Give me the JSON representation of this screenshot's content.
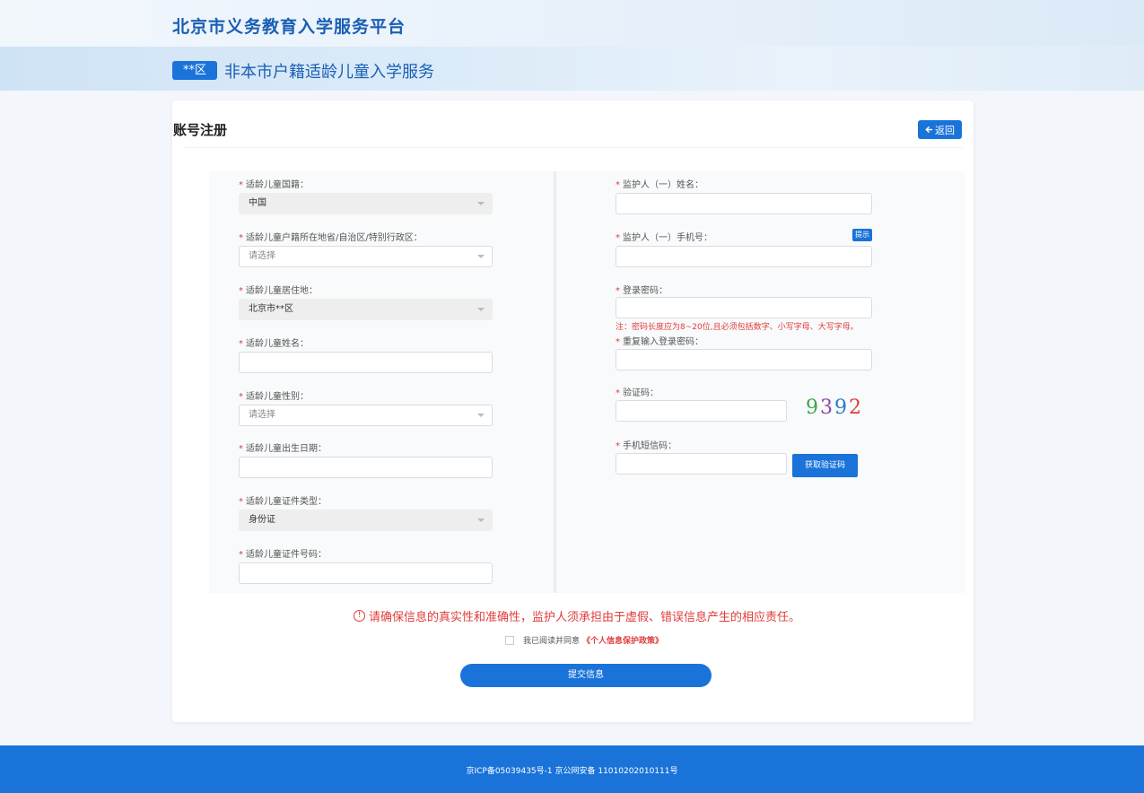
{
  "header": {
    "site_title": "北京市义务教育入学服务平台",
    "district_badge": "**区",
    "service_title": "非本市户籍适龄儿童入学服务"
  },
  "card": {
    "title": "账号注册",
    "back_label": "返回"
  },
  "left_fields": {
    "nationality": {
      "label": "适龄儿童国籍：",
      "value": "中国"
    },
    "huji_province": {
      "label": "适龄儿童户籍所在地省/自治区/特别行政区：",
      "placeholder": "请选择"
    },
    "residence": {
      "label": "适龄儿童居住地：",
      "value": "北京市**区"
    },
    "name": {
      "label": "适龄儿童姓名：",
      "value": ""
    },
    "gender": {
      "label": "适龄儿童性别：",
      "placeholder": "请选择"
    },
    "birthdate": {
      "label": "适龄儿童出生日期：",
      "value": ""
    },
    "id_type": {
      "label": "适龄儿童证件类型：",
      "value": "身份证"
    },
    "id_number": {
      "label": "适龄儿童证件号码：",
      "value": ""
    }
  },
  "right_fields": {
    "guardian_name": {
      "label": "监护人（一）姓名：",
      "value": ""
    },
    "guardian_phone": {
      "label": "监护人（一）手机号：",
      "value": "",
      "hint_label": "提示"
    },
    "password": {
      "label": "登录密码：",
      "value": "",
      "note": "注：密码长度应为8~20位,且必须包括数字、小写字母、大写字母。"
    },
    "password_confirm": {
      "label": "重复输入登录密码：",
      "value": ""
    },
    "captcha": {
      "label": "验证码：",
      "value": "",
      "image_text": [
        "9",
        "3",
        "9",
        "2"
      ]
    },
    "sms_code": {
      "label": "手机短信码：",
      "value": "",
      "button_label": "获取验证码"
    }
  },
  "footer_form": {
    "warning_icon": "!",
    "warning": "请确保信息的真实性和准确性，监护人须承担由于虚假、错误信息产生的相应责任。",
    "agree_text": "我已阅读并同意",
    "agree_link": "《个人信息保护政策》",
    "agree_checked": false,
    "submit_label": "提交信息"
  },
  "footer": {
    "icp": "京ICP备05039435号-1 京公网安备 11010202010111号"
  },
  "colors": {
    "primary": "#1a73d9",
    "danger": "#e03c3c",
    "title_blue": "#1a5fb4"
  }
}
